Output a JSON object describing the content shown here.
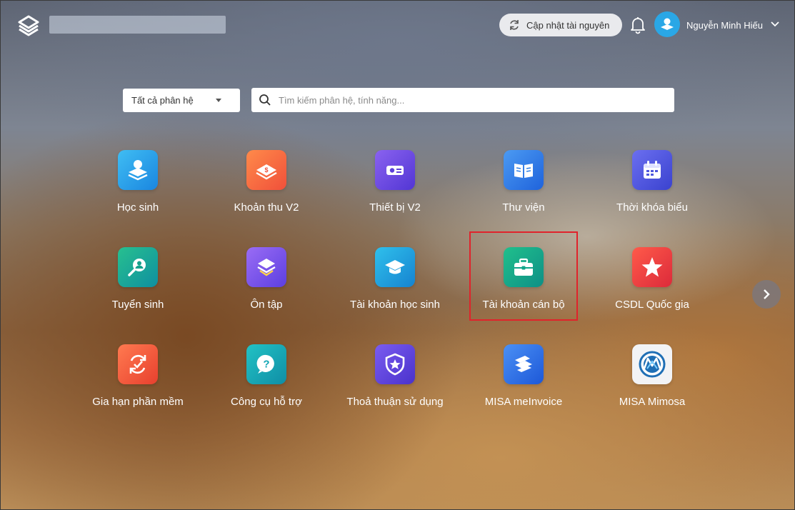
{
  "header": {
    "update_label": "Cập nhật tài nguyên",
    "user_name": "Nguyễn Minh Hiếu"
  },
  "filter": {
    "selected": "Tất cả phân hệ",
    "search_placeholder": "Tìm kiếm phân hệ, tính năng..."
  },
  "apps": [
    {
      "label": "Học sinh",
      "icon": "student-icon",
      "color": "#2fa7ea"
    },
    {
      "label": "Khoản thu V2",
      "icon": "fee-icon",
      "color": "#f56b3a"
    },
    {
      "label": "Thiết bị V2",
      "icon": "projector-icon",
      "color": "#6a4ce0"
    },
    {
      "label": "Thư viện",
      "icon": "book-icon",
      "color": "#2e7fe6"
    },
    {
      "label": "Thời khóa biểu",
      "icon": "calendar-icon",
      "color": "#4e57dd"
    },
    {
      "label": "Tuyển sinh",
      "icon": "admission-icon",
      "color": "#17a58c"
    },
    {
      "label": "Ôn tập",
      "icon": "review-icon",
      "color": "#7a4fe6"
    },
    {
      "label": "Tài khoản học sinh",
      "icon": "graduation-cap-icon",
      "color": "#1aa3d9"
    },
    {
      "label": "Tài khoản cán bộ",
      "icon": "briefcase-icon",
      "color": "#12a58a"
    },
    {
      "label": "CSDL Quốc gia",
      "icon": "star-icon",
      "color": "#ee3e3e"
    },
    {
      "label": "Gia hạn phần mềm",
      "icon": "renew-icon",
      "color": "#f0573a"
    },
    {
      "label": "Công cụ hỗ trợ",
      "icon": "help-icon",
      "color": "#12a6b5"
    },
    {
      "label": "Thoả thuận sử dụng",
      "icon": "shield-icon",
      "color": "#5b45d8"
    },
    {
      "label": "MISA meInvoice",
      "icon": "meinvoice-icon",
      "color": "#2a73e8"
    },
    {
      "label": "MISA Mimosa",
      "icon": "mimosa-icon",
      "color": "#f2f2f4"
    }
  ]
}
